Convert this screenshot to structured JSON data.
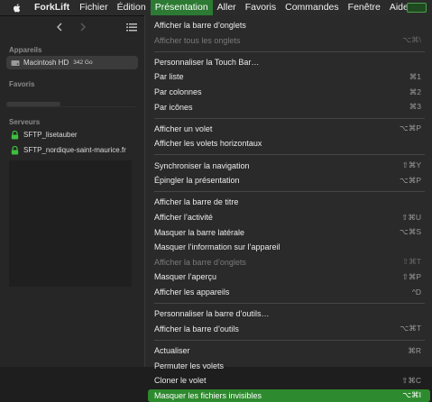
{
  "menubar": {
    "app_name": "ForkLift",
    "items": [
      "Fichier",
      "Édition",
      "Présentation",
      "Aller",
      "Favoris",
      "Commandes",
      "Fenêtre",
      "Aide"
    ],
    "active_index": 2
  },
  "sidebar": {
    "sections": {
      "devices": "Appareils",
      "favorites": "Favoris",
      "servers": "Serveurs"
    },
    "devices": [
      {
        "label": "Macintosh HD",
        "size": "342 Go",
        "icon": "drive-icon",
        "selected": true
      }
    ],
    "servers": [
      {
        "label": "SFTP_lisetauber",
        "icon": "lock-icon"
      },
      {
        "label": "SFTP_nordique-saint-maurice.fr",
        "icon": "lock-icon"
      }
    ]
  },
  "menu": {
    "groups": [
      [
        {
          "label": "Afficher la barre d’onglets",
          "shortcut": "",
          "disabled": false
        },
        {
          "label": "Afficher tous les onglets",
          "shortcut": "⌥⌘\\",
          "disabled": true
        }
      ],
      [
        {
          "label": "Personnaliser la Touch Bar…",
          "shortcut": "",
          "disabled": false
        },
        {
          "label": "Par liste",
          "shortcut": "⌘1",
          "disabled": false
        },
        {
          "label": "Par colonnes",
          "shortcut": "⌘2",
          "disabled": false
        },
        {
          "label": "Par icônes",
          "shortcut": "⌘3",
          "disabled": false
        }
      ],
      [
        {
          "label": "Afficher un volet",
          "shortcut": "⌥⌘P",
          "disabled": false
        },
        {
          "label": "Afficher les volets horizontaux",
          "shortcut": "",
          "disabled": false
        }
      ],
      [
        {
          "label": "Synchroniser la navigation",
          "shortcut": "⇧⌘Y",
          "disabled": false
        },
        {
          "label": "Épingler la présentation",
          "shortcut": "⌥⌘P",
          "disabled": false
        }
      ],
      [
        {
          "label": "Afficher la barre de titre",
          "shortcut": "",
          "disabled": false
        },
        {
          "label": "Afficher l’activité",
          "shortcut": "⇧⌘U",
          "disabled": false
        },
        {
          "label": "Masquer la barre latérale",
          "shortcut": "⌥⌘S",
          "disabled": false
        },
        {
          "label": "Masquer l’information sur l’appareil",
          "shortcut": "",
          "disabled": false
        },
        {
          "label": "Afficher la barre d’onglets",
          "shortcut": "⇧⌘T",
          "disabled": true
        },
        {
          "label": "Masquer l’aperçu",
          "shortcut": "⇧⌘P",
          "disabled": false
        },
        {
          "label": "Afficher les appareils",
          "shortcut": "^D",
          "disabled": false
        }
      ],
      [
        {
          "label": "Personnaliser la barre d’outils…",
          "shortcut": "",
          "disabled": false
        },
        {
          "label": "Afficher la barre d’outils",
          "shortcut": "⌥⌘T",
          "disabled": false
        }
      ],
      [
        {
          "label": "Actualiser",
          "shortcut": "⌘R",
          "disabled": false
        },
        {
          "label": "Permuter les volets",
          "shortcut": "",
          "disabled": false
        },
        {
          "label": "Cloner le volet",
          "shortcut": "⇧⌘C",
          "disabled": false
        },
        {
          "label": "Masquer les fichiers invisibles",
          "shortcut": "⌥⌘I",
          "disabled": false,
          "highlighted": true
        }
      ]
    ]
  },
  "colors": {
    "accent": "#2e8a2e",
    "menu_bg": "#2a2a2a",
    "sidebar_bg": "#262626"
  }
}
